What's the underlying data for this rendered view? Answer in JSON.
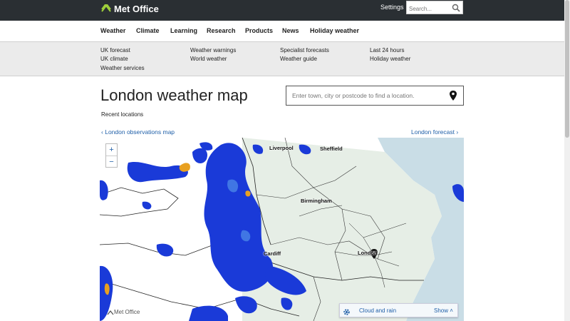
{
  "header": {
    "logo_text": "Met Office",
    "settings_label": "Settings",
    "search_placeholder": "Search..."
  },
  "nav": {
    "items": [
      "Weather",
      "Climate",
      "Learning",
      "Research",
      "Products",
      "News",
      "Holiday weather"
    ]
  },
  "subnav": {
    "col1": [
      "UK forecast",
      "UK climate",
      "Weather services"
    ],
    "col2": [
      "Weather warnings",
      "World weather"
    ],
    "col3": [
      "Specialist forecasts",
      "Weather guide"
    ],
    "col4": [
      "Last 24 hours",
      "Holiday weather"
    ]
  },
  "page": {
    "title": "London weather map",
    "location_placeholder": "Enter town, city or postcode to find a location.",
    "recent_locations": "Recent locations",
    "prev_link": "London observations map",
    "next_link": "London forecast"
  },
  "map": {
    "zoom_in": "+",
    "zoom_out": "−",
    "cities": [
      "Liverpool",
      "Sheffield",
      "Birmingham",
      "Cardiff",
      "London"
    ],
    "watermark": "Met Office",
    "layer_label": "Cloud and rain",
    "layer_toggle": "Show"
  },
  "colors": {
    "header_bg": "#2a2f33",
    "link": "#1f5fa8",
    "rain": "#1a3ad8",
    "land": "#e8efe8",
    "sea": "#c9dde6"
  }
}
